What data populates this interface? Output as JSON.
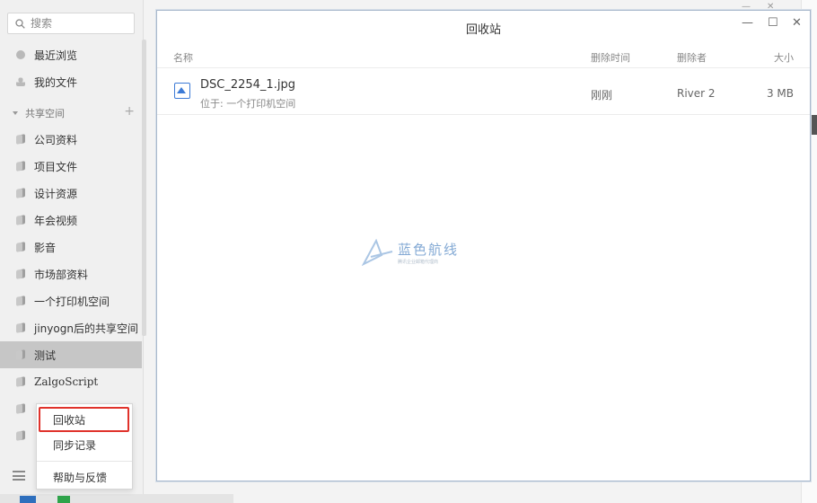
{
  "sidebar": {
    "search_placeholder": "搜索",
    "recent": "最近浏览",
    "my_files": "我的文件",
    "shared_header": "共享空间",
    "spaces": [
      "公司资料",
      "项目文件",
      "设计资源",
      "年会视频",
      "影音",
      "市场部资料",
      "一个打印机空间",
      "jinyogn后的共享空间",
      "测试",
      "ZalgoScript"
    ],
    "active_space": "测试"
  },
  "popup_menu": {
    "items": [
      "回收站",
      "同步记录",
      "帮助与反馈"
    ]
  },
  "window": {
    "title": "回收站",
    "columns": {
      "name": "名称",
      "deleted_time": "删除时间",
      "deleted_by": "删除者",
      "size": "大小"
    },
    "files": [
      {
        "name": "DSC_2254_1.jpg",
        "location": "位于: 一个打印机空间",
        "deleted_time": "刚刚",
        "deleted_by": "River 2",
        "size": "3 MB"
      }
    ]
  },
  "watermark": {
    "title": "蓝色航线",
    "subtitle": "腾讯企业邮箱代理商"
  },
  "colors": {
    "accent_blue": "#3d7bd6",
    "highlight_red": "#e0322b",
    "active_bg": "#c6c6c6"
  }
}
